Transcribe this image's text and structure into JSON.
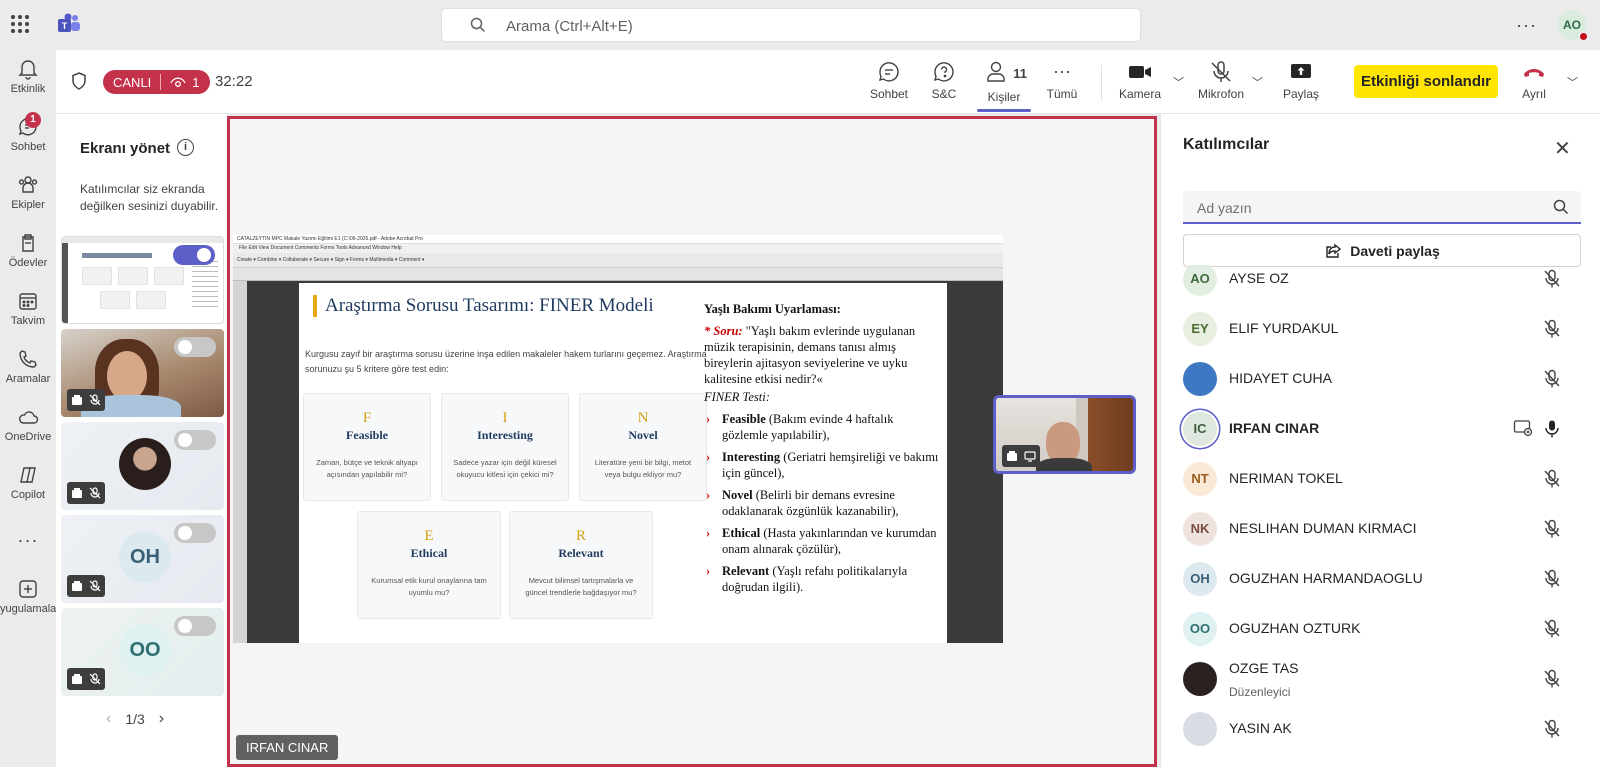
{
  "search": {
    "placeholder": "Arama (Ctrl+Alt+E)"
  },
  "user": {
    "initials": "AO"
  },
  "rail": [
    {
      "label": "Etkinlik",
      "icon": "bell-icon"
    },
    {
      "label": "Sohbet",
      "icon": "chat-icon",
      "badge": "1"
    },
    {
      "label": "Ekipler",
      "icon": "teams-icon"
    },
    {
      "label": "Ödevler",
      "icon": "assignments-icon"
    },
    {
      "label": "Takvim",
      "icon": "calendar-icon"
    },
    {
      "label": "Aramalar",
      "icon": "phone-icon"
    },
    {
      "label": "OneDrive",
      "icon": "cloud-icon"
    },
    {
      "label": "Copilot",
      "icon": "copilot-icon"
    },
    {
      "label": "yugulamalar",
      "icon": "add-apps-icon"
    }
  ],
  "meeting": {
    "live_label": "CANLI",
    "viewers": "1",
    "timer": "32:22",
    "toolbar": {
      "chat": "Sohbet",
      "qa": "S&C",
      "people": "Kişiler",
      "people_count": "11",
      "more": "Tümü",
      "camera": "Kamera",
      "mic": "Mikrofon",
      "share": "Paylaş",
      "end": "Etkinliği sonlandır",
      "leave": "Ayrıl"
    }
  },
  "manage": {
    "title": "Ekranı yönet",
    "desc": "Katılımcılar siz ekranda değilken sesinizi duyabilir.",
    "thumbs": [
      {
        "initials": ""
      },
      {
        "initials": ""
      },
      {
        "initials": ""
      },
      {
        "initials": "OH"
      },
      {
        "initials": "OO"
      }
    ],
    "page": "1/3"
  },
  "stage": {
    "presenter": "IRFAN CINAR",
    "acrobat": {
      "title": "CATALZEYTIN MPC Makale Yazımı Eğitimi E1 (C:\\06-2026.pdf - Adobe Acrobat Pro",
      "menu": "File  Edit  View  Document  Comments  Forms  Tools  Advanced  Window  Help",
      "tools": "Create ▾   Combine ▾   Collaborate ▾   Secure ▾   Sign ▾   Forms ▾   Multimedia ▾   Comment ▾"
    },
    "slide": {
      "title": "Araştırma Sorusu Tasarımı: FINER Modeli",
      "desc": "Kurgusu zayıf bir araştırma sorusu üzerine inşa edilen makaleler hakem turlarını geçemez. Araştırma sorunuzu şu 5 kritere göre test edin:",
      "cards": [
        {
          "letter": "F",
          "name": "Feasible",
          "desc": "Zaman, bütçe ve teknik altyapı açısından yapılabilir mi?"
        },
        {
          "letter": "I",
          "name": "Interesting",
          "desc": "Sadece yazar için değil küresel okuyucu kitlesi için çekici mi?"
        },
        {
          "letter": "N",
          "name": "Novel",
          "desc": "Literatüre yeni bir bilgi, metot veya bulgu ekliyor mu?"
        },
        {
          "letter": "E",
          "name": "Ethical",
          "desc": "Kurumsal etik kurul onaylarına tam uyumlu mu?"
        },
        {
          "letter": "R",
          "name": "Relevant",
          "desc": "Mevcut bilimsel tartışmalarla ve güncel trendlerle bağdaşıyor mu?"
        }
      ],
      "right": {
        "heading": "Yaşlı Bakımı Uyarlaması:",
        "q_label": "* Soru:",
        "question": "\"Yaşlı bakım evlerinde uygulanan müzik terapisinin, demans tanısı almış bireylerin ajitasyon seviyelerine ve uyku kalitesine etkisi nedir?«",
        "test": "FINER Testi:",
        "bullets": [
          {
            "term": "Feasible",
            "text": " (Bakım evinde 4 haftalık gözlemle yapılabilir),"
          },
          {
            "term": "Interesting",
            "text": " (Geriatri hemşireliği ve bakımı için güncel),"
          },
          {
            "term": "Novel",
            "text": " (Belirli bir demans evresine odaklanarak özgünlük kazanabilir),"
          },
          {
            "term": "Ethical",
            "text": " (Hasta yakınlarından ve kurumdan onam alınarak çözülür),"
          },
          {
            "term": "Relevant",
            "text": " (Yaşlı refahı politikalarıyla doğrudan ilgili)."
          }
        ]
      }
    }
  },
  "participants": {
    "title": "Katılımcılar",
    "search_placeholder": "Ad yazın",
    "share_label": "Daveti paylaş",
    "list": [
      {
        "initials": "AO",
        "name": "AYSE OZ",
        "bg": "#e3eee3",
        "fg": "#3d6b3d"
      },
      {
        "initials": "EY",
        "name": "ELIF YURDAKUL",
        "bg": "#e8efe0",
        "fg": "#4a6b2e"
      },
      {
        "initials": "",
        "name": "HIDAYET CUHA",
        "bg": "#3f78c2",
        "fg": "#ffffff"
      },
      {
        "initials": "IC",
        "name": "IRFAN CINAR",
        "bg": "#dfe8df",
        "fg": "#3d5a3d",
        "speaking": true
      },
      {
        "initials": "NT",
        "name": "NERIMAN TOKEL",
        "bg": "#fbe9d8",
        "fg": "#9a5a1e"
      },
      {
        "initials": "NK",
        "name": "NESLIHAN DUMAN KIRMACI",
        "bg": "#efe3e0",
        "fg": "#7a4a40"
      },
      {
        "initials": "OH",
        "name": "OGUZHAN HARMANDAOGLU",
        "bg": "#dce9ef",
        "fg": "#3a5f74"
      },
      {
        "initials": "OO",
        "name": "OGUZHAN OZTURK",
        "bg": "#dff1f1",
        "fg": "#2e7070"
      },
      {
        "initials": "",
        "name": "OZGE TAS",
        "sub": "Düzenleyici",
        "bg": "#2a2220",
        "fg": "#ffffff"
      },
      {
        "initials": "",
        "name": "YASIN AK",
        "bg": "#d7dde3",
        "fg": "#333333"
      }
    ]
  },
  "colors": {
    "accent": "#5b5fc7",
    "live": "#c4314b",
    "end_button": "#ffe500",
    "stage_border": "#c4314b"
  }
}
